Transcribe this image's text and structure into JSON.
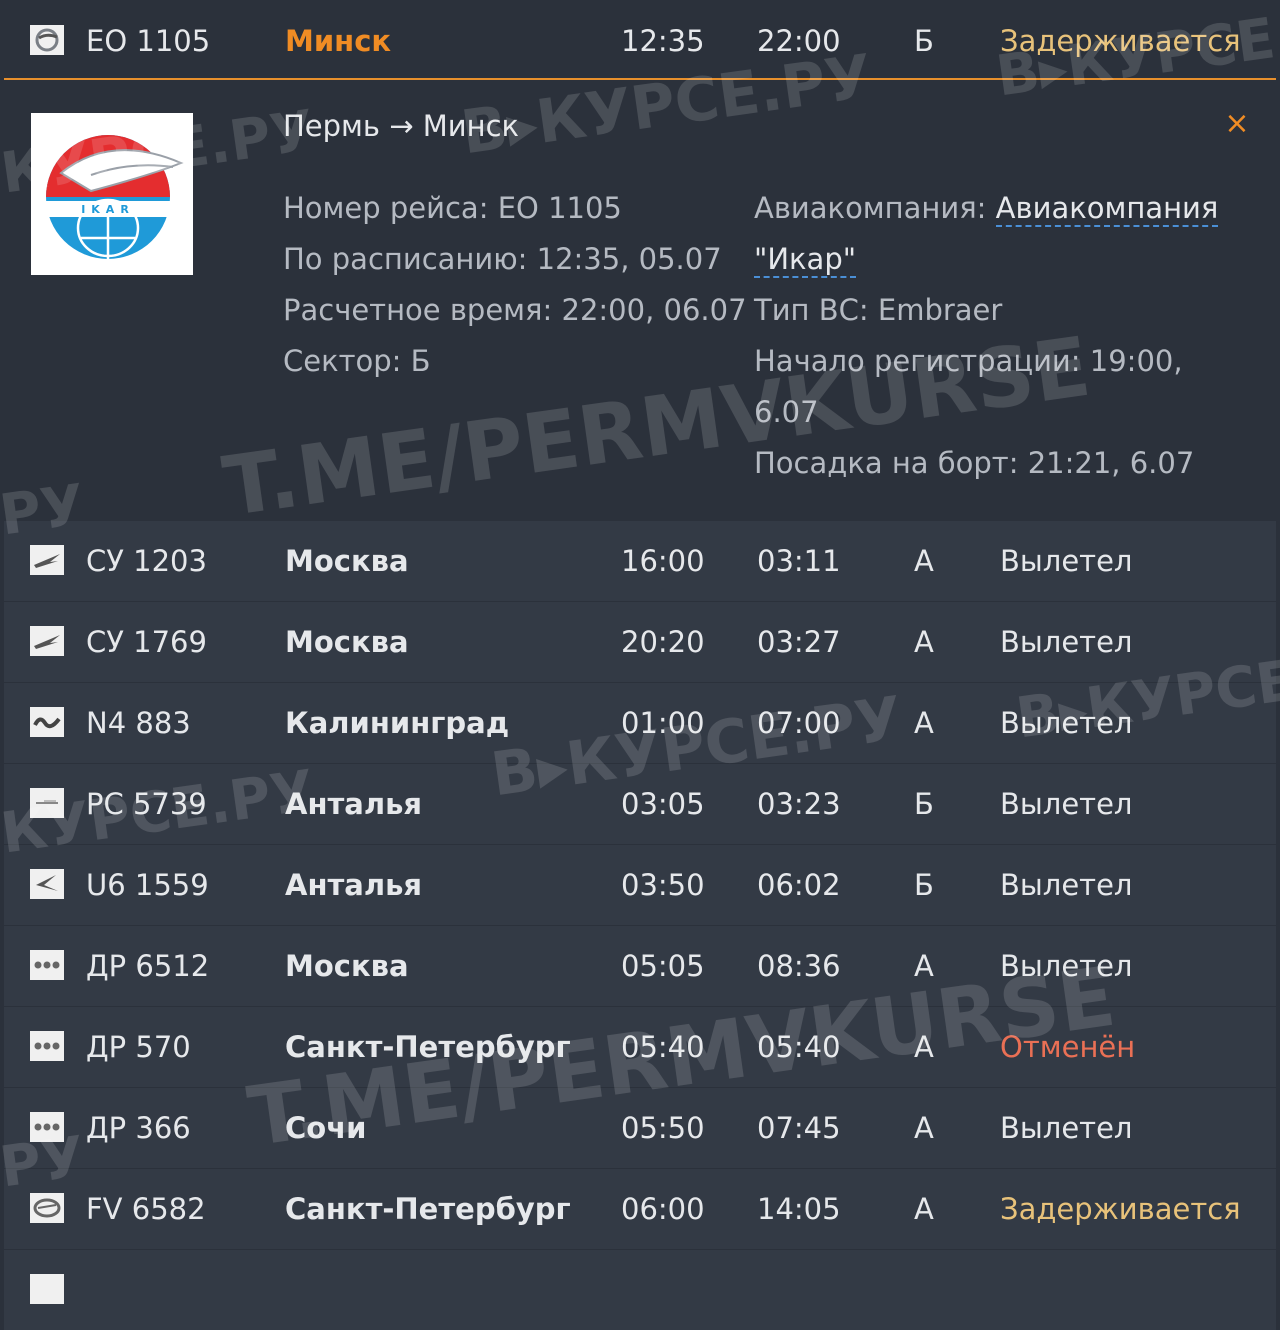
{
  "open_flight": {
    "flight": "ЕО 1105",
    "destination": "Минск",
    "scheduled": "12:35",
    "estimated": "22:00",
    "sector": "Б",
    "status": "Задерживается",
    "details": {
      "route": "Пермь → Минск",
      "flight_label": "Номер рейса:",
      "flight_value": "ЕО 1105",
      "scheduled_label": "По расписанию:",
      "scheduled_value": "12:35, 05.07",
      "estimated_label": "Расчетное время:",
      "estimated_value": "22:00, 06.07",
      "sector_label": "Сектор:",
      "sector_value": "Б",
      "airline_label": "Авиакомпания:",
      "airline_value_1": "Авиакомпания",
      "airline_value_2": "\"Икар\"",
      "aircraft_label": "Тип ВС:",
      "aircraft_value": "Embraer",
      "checkin_label": "Начало регистрации:",
      "checkin_value_1": "19:00,",
      "checkin_value_2": "6.07",
      "boarding_label": "Посадка на борт:",
      "boarding_value": "21:21, 6.07",
      "close_icon": "×",
      "logo_text": "IKAR"
    }
  },
  "flights": [
    {
      "flight": "СУ 1203",
      "destination": "Москва",
      "scheduled": "16:00",
      "estimated": "03:11",
      "sector": "А",
      "status": "Вылетел",
      "state": "departed",
      "logo": "aeroflot"
    },
    {
      "flight": "СУ 1769",
      "destination": "Москва",
      "scheduled": "20:20",
      "estimated": "03:27",
      "sector": "А",
      "status": "Вылетел",
      "state": "departed",
      "logo": "aeroflot"
    },
    {
      "flight": "N4 883",
      "destination": "Калининград",
      "scheduled": "01:00",
      "estimated": "07:00",
      "sector": "А",
      "status": "Вылетел",
      "state": "departed",
      "logo": "nordwind"
    },
    {
      "flight": "РС 5739",
      "destination": "Анталья",
      "scheduled": "03:05",
      "estimated": "03:23",
      "sector": "Б",
      "status": "Вылетел",
      "state": "departed",
      "logo": "pegas"
    },
    {
      "flight": "U6 1559",
      "destination": "Анталья",
      "scheduled": "03:50",
      "estimated": "06:02",
      "sector": "Б",
      "status": "Вылетел",
      "state": "departed",
      "logo": "ural"
    },
    {
      "flight": "ДР 6512",
      "destination": "Москва",
      "scheduled": "05:05",
      "estimated": "08:36",
      "sector": "А",
      "status": "Вылетел",
      "state": "departed",
      "logo": "pobeda"
    },
    {
      "flight": "ДР 570",
      "destination": "Санкт-Петербург",
      "scheduled": "05:40",
      "estimated": "05:40",
      "sector": "А",
      "status": "Отменён",
      "state": "cancelled",
      "logo": "pobeda"
    },
    {
      "flight": "ДР 366",
      "destination": "Сочи",
      "scheduled": "05:50",
      "estimated": "07:45",
      "sector": "А",
      "status": "Вылетел",
      "state": "departed",
      "logo": "pobeda"
    },
    {
      "flight": "FV 6582",
      "destination": "Санкт-Петербург",
      "scheduled": "06:00",
      "estimated": "14:05",
      "sector": "А",
      "status": "Задерживается",
      "state": "delayed",
      "logo": "rossiya"
    }
  ],
  "watermarks": {
    "vkurse": "В▸КУРСЕ.РУ",
    "permvkurse": "T.ME/PERMVKURSE",
    "ru": "РУ",
    "vk": "В▸КУРСЕ",
    "kurse": "КУРСЕ.РУ"
  },
  "colors": {
    "background": "#2b313b",
    "row": "#333a45",
    "accent": "#f08c24",
    "delayed": "#e8c27a",
    "cancelled": "#ea7055",
    "link_underline": "#4a8fd6"
  }
}
